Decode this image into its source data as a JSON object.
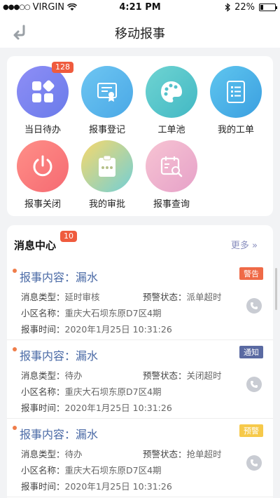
{
  "status_bar": {
    "signal": "●●●○○",
    "carrier": "VIRGIN",
    "time": "4:21 PM",
    "battery": "22%",
    "battery_level": 0.22
  },
  "nav": {
    "title": "移动报事"
  },
  "grid": [
    {
      "label": "当日待办",
      "badge": "128",
      "icon": "tiles-icon",
      "color_a": "#8e8ef6",
      "color_b": "#6a7bea"
    },
    {
      "label": "报事登记",
      "icon": "certificate-icon",
      "color_a": "#6ec6f2",
      "color_b": "#4aa8e6"
    },
    {
      "label": "工单池",
      "icon": "palette-icon",
      "color_a": "#6fd4d2",
      "color_b": "#42b8c4"
    },
    {
      "label": "我的工单",
      "icon": "list-document-icon",
      "color_a": "#5fc6ef",
      "color_b": "#3b9fe0"
    },
    {
      "label": "报事关闭",
      "icon": "power-icon",
      "color_a": "#ff8f88",
      "color_b": "#f56a72"
    },
    {
      "label": "我的审批",
      "icon": "clipboard-icon",
      "color_a": "#f7d86b",
      "color_b": "#72cfd6"
    },
    {
      "label": "报事查询",
      "icon": "calendar-search-icon",
      "color_a": "#f7c4d3",
      "color_b": "#e6a1c8"
    }
  ],
  "messages": {
    "title": "消息中心",
    "badge": "10",
    "more": "更多 »",
    "items": [
      {
        "headline": "报事内容：漏水",
        "tag": "警告",
        "tag_color": "#ef6a47",
        "type_label": "消息类型：",
        "type": "延时审核",
        "warn_label": "预警状态：",
        "warn": "派单超时",
        "area_label": "小区名称：",
        "area": "重庆大石坝东原D7区4期",
        "time_label": "报事时间：",
        "time": "2020年1月25日 10:31:26"
      },
      {
        "headline": "报事内容：漏水",
        "tag": "通知",
        "tag_color": "#5a6aa2",
        "type_label": "消息类型：",
        "type": "待办",
        "warn_label": "预警状态：",
        "warn": "关闭超时",
        "area_label": "小区名称：",
        "area": "重庆大石坝东原D7区4期",
        "time_label": "报事时间：",
        "time": "2020年1月25日 10:31:26"
      },
      {
        "headline": "报事内容：漏水",
        "tag": "预警",
        "tag_color": "#f6c94a",
        "type_label": "消息类型：",
        "type": "待办",
        "warn_label": "预警状态：",
        "warn": "抢单超时",
        "area_label": "小区名称：",
        "area": "重庆大石坝东原D7区4期",
        "time_label": "报事时间：",
        "time": "2020年1月25日 10:31:26"
      }
    ]
  }
}
